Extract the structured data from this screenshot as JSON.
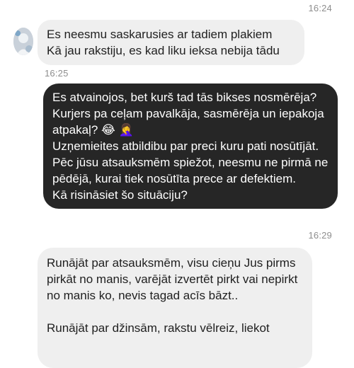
{
  "messages": [
    {
      "time": "16:24"
    },
    {
      "sender": "other",
      "text": "Es neesmu saskarusies ar tadiem plakiem\nKā jau rakstiju, es kad liku ieksa nebija tādu",
      "time": "16:25"
    },
    {
      "sender": "me",
      "text": "Es atvainojos, bet kurš tad tās bikses nosmērēja? Kurjers pa ceļam pavalkāja, sasmērēja un iepakoja atpakaļ? 😂 🤦‍♀️\nUzņemieites atbildibu par preci kuru pati nosūtījāt. Pēc jūsu atsauksmēm spiežot, neesmu ne pirmā ne pēdējā, kurai tiek nosūtīta prece ar defektiem.\nKā risināsiet šo situāciju?",
      "time": "16:29"
    },
    {
      "sender": "other",
      "text": "Runājāt par atsauksmēm, visu cieņu Jus pirms pirkāt no manis, varējāt izvertēt pirkt vai nepirkt no manis ko, nevis tagad acīs bāzt..\n\nRunājāt par džinsām, rakstu vēlreiz, liekot"
    }
  ]
}
